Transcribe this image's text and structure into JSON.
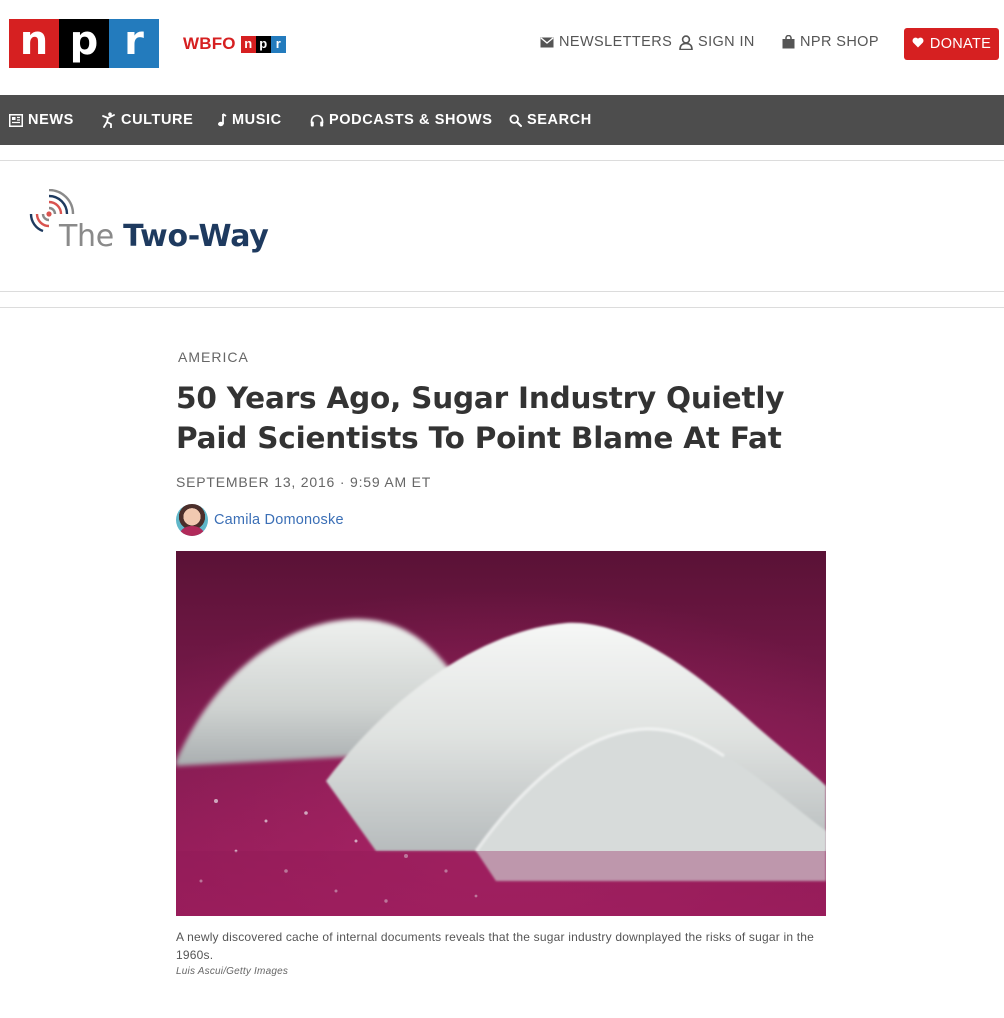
{
  "header": {
    "logo_letters": [
      "n",
      "p",
      "r"
    ],
    "station": {
      "name": "WBFO",
      "badge_letters": [
        "n",
        "p",
        "r"
      ]
    },
    "utility": {
      "newsletters": "NEWSLETTERS",
      "sign_in": "SIGN IN",
      "shop": "NPR SHOP",
      "donate": "DONATE"
    },
    "colors": {
      "brand_red": "#d62021",
      "brand_black": "#000000",
      "brand_blue": "#237bbd",
      "nav_bg": "#4d4d4d"
    }
  },
  "nav": {
    "items": [
      {
        "label": "NEWS",
        "icon": "news-icon"
      },
      {
        "label": "CULTURE",
        "icon": "culture-icon"
      },
      {
        "label": "MUSIC",
        "icon": "music-icon"
      },
      {
        "label": "PODCASTS & SHOWS",
        "icon": "headphones-icon"
      },
      {
        "label": "SEARCH",
        "icon": "search-icon"
      }
    ]
  },
  "blog": {
    "title_prefix": "The",
    "title_name": "Two-Way",
    "icon": "broadcast-signal-icon"
  },
  "article": {
    "slug": "AMERICA",
    "headline": "50 Years Ago, Sugar Industry Quietly Paid Scientists To Point Blame At Fat",
    "date": "SEPTEMBER 13, 2016 · 9:59 AM ET",
    "author": "Camila Domonoske",
    "image": {
      "subject": "piles of white sugar on magenta surface",
      "caption": "A newly discovered cache of internal documents reveals that the sugar industry downplayed the risks of sugar in the 1960s.",
      "credit": "Luis Ascui/Getty Images"
    }
  }
}
